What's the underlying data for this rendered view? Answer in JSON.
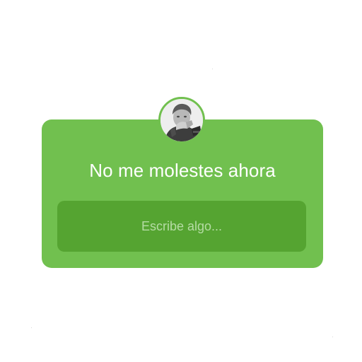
{
  "question_sticker": {
    "avatar": {
      "icon": "profile-photo-icon"
    },
    "question": "No me molestes ahora",
    "reply_placeholder": "Escribe algo...",
    "colors": {
      "card": "#71c04f",
      "reply_field": "#55a431",
      "question_text": "#ffffff",
      "placeholder_text": "#b5dca4"
    }
  }
}
